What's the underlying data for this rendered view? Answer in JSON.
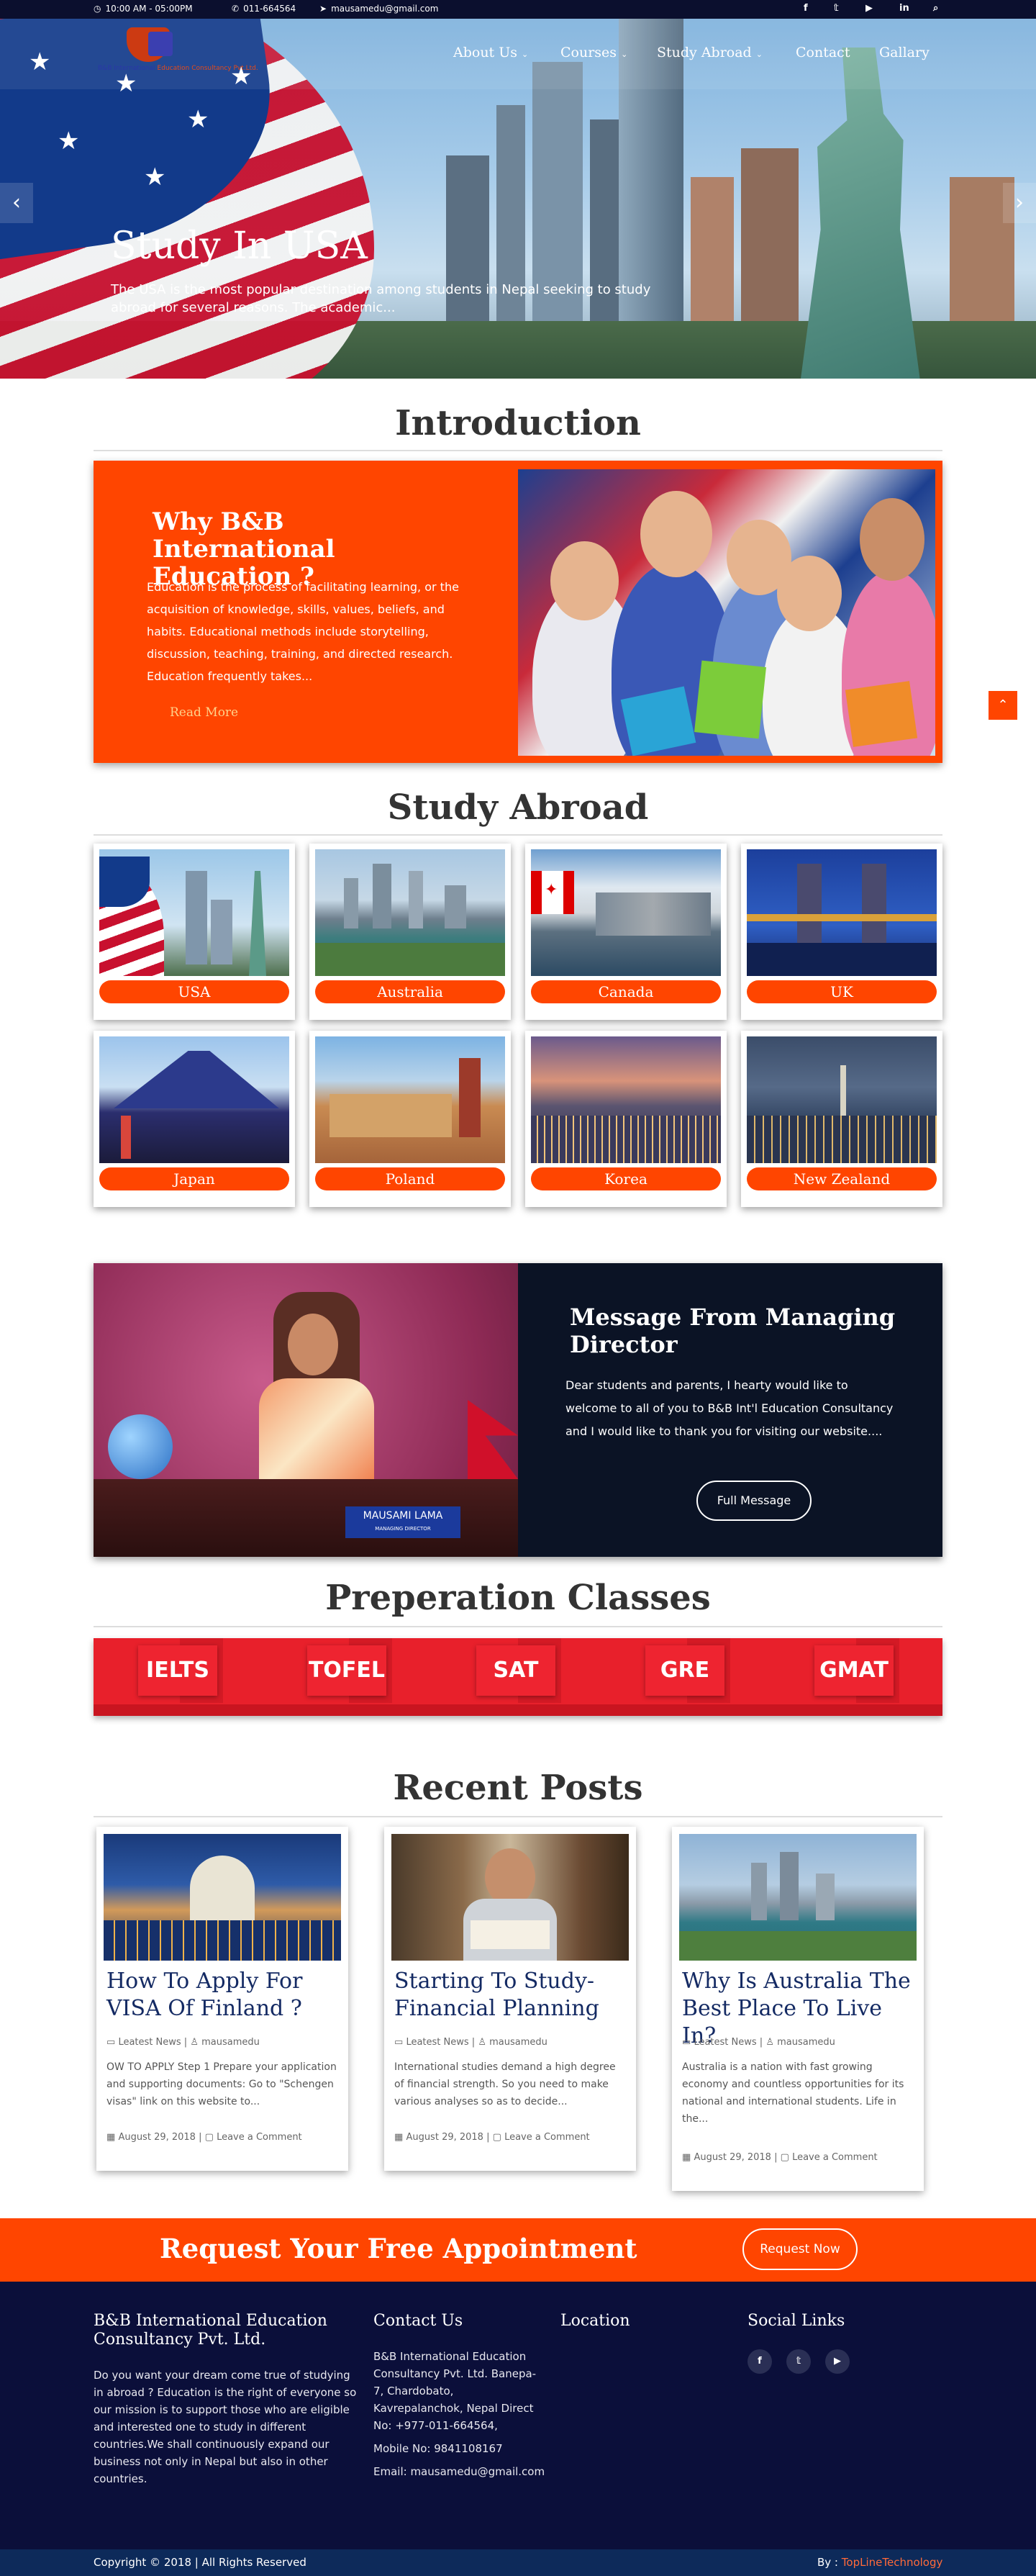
{
  "topbar": {
    "hours": "10:00 AM - 05:00PM",
    "phone": "011-664564",
    "email": "mausamedu@gmail.com",
    "social": [
      "f",
      "t",
      "yt",
      "in",
      "search"
    ]
  },
  "nav": {
    "logo_text_1": "B&B International",
    "logo_text_2": "Education Consultancy Pvt.Ltd.",
    "items": [
      {
        "label": "About Us",
        "has_dropdown": true
      },
      {
        "label": "Courses",
        "has_dropdown": true
      },
      {
        "label": "Study Abroad",
        "has_dropdown": true
      },
      {
        "label": "Contact",
        "has_dropdown": false
      },
      {
        "label": "Gallary",
        "has_dropdown": false
      }
    ]
  },
  "hero": {
    "title": "Study In USA",
    "text": "The USA is the most popular destination among students in Nepal seeking to study abroad for several reasons. The academic..."
  },
  "intro": {
    "heading": "Introduction",
    "card_title": "Why B&B International Education ?",
    "text": "Education is the process of facilitating learning, or the acquisition of knowledge, skills, values, beliefs, and habits. Educational methods include storytelling, discussion, teaching, training, and directed research. Education frequently takes...",
    "read_more": "Read More"
  },
  "study_abroad": {
    "heading": "Study Abroad",
    "countries": [
      "USA",
      "Australia",
      "Canada",
      "UK",
      "Japan",
      "Poland",
      "Korea",
      "New Zealand"
    ]
  },
  "message": {
    "title": "Message From Managing Director",
    "text": "Dear students and parents, I hearty would like to welcome to all of you to B&B Int'l Education Consultancy and I would like to thank you for visiting our website....",
    "button": "Full Message",
    "nameplate": "MAUSAMI LAMA",
    "nameplate_sub": "MANAGING DIRECTOR"
  },
  "prep": {
    "heading": "Preperation Classes",
    "classes": [
      "IELTS",
      "TOFEL",
      "SAT",
      "GRE",
      "GMAT"
    ]
  },
  "posts": {
    "heading": "Recent Posts",
    "items": [
      {
        "title": "How To Apply For VISA Of Finland ?",
        "category": "Leatest News",
        "author": "mausamedu",
        "excerpt": "OW TO APPLY Step 1 Prepare your application and supporting documents: Go to \"Schengen visas\" link on this website to...",
        "date": "August 29, 2018",
        "comment": "Leave a Comment"
      },
      {
        "title": "Starting To Study- Financial Planning",
        "category": "Leatest News",
        "author": "mausamedu",
        "excerpt": "International studies demand a high degree of financial strength. So you need to make various analyses so as to decide...",
        "date": "August 29, 2018",
        "comment": "Leave a Comment"
      },
      {
        "title": "Why Is Australia The Best Place To Live In?",
        "category": "Leatest News",
        "author": "mausamedu",
        "excerpt": "Australia is a nation with fast growing economy and countless opportunities for its national and international students. Life in the...",
        "date": "August 29, 2018",
        "comment": "Leave a Comment"
      }
    ]
  },
  "appointment": {
    "title": "Request Your Free Appointment",
    "button": "Request Now"
  },
  "footer": {
    "about_title": "B&B International Education Consultancy Pvt. Ltd.",
    "about_text": "Do you want your dream come true of studying in abroad ? Education is the right of everyone so our mission is to support those who are eligible and interested one to study in different countries.We shall continuously expand our business not only in Nepal but also in other countries.",
    "contact_title": "Contact Us",
    "contact_text": "B&B International Education Consultancy Pvt. Ltd. Banepa-7, Chardobato, Kavrepalanchok, Nepal Direct No: +977-011-664564,",
    "mobile": "Mobile No: 9841108167",
    "email": "Email: mausamedu@gmail.com",
    "location_title": "Location",
    "social_title": "Social Links",
    "social": [
      "f",
      "t",
      "yt"
    ],
    "copyright": "Copyright © 2018 | All Rights Reserved",
    "by_label": "By :",
    "by_name": "TopLineTechnology"
  },
  "colors": {
    "accent": "#ff4500",
    "navy": "#0b0f3a",
    "prep_red": "#e8202b"
  }
}
